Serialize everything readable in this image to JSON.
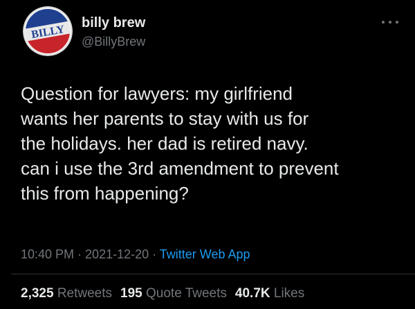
{
  "user": {
    "display_name": "billy brew",
    "handle": "@BillyBrew",
    "avatar_text": "BILLY"
  },
  "tweet": {
    "lines": [
      "Question for lawyers: my girlfriend",
      "wants her parents to stay with us for",
      "the holidays. her dad is retired navy.",
      "can i use the 3rd amendment to prevent",
      "this from happening?"
    ]
  },
  "meta": {
    "time": "10:40 PM",
    "separator": " · ",
    "date": "2021-12-20",
    "source": "Twitter Web App"
  },
  "stats": {
    "retweets_count": "2,325",
    "retweets_label": "Retweets",
    "quotes_count": "195",
    "quotes_label": "Quote Tweets",
    "likes_count": "40.7K",
    "likes_label": "Likes"
  },
  "icons": {
    "more": "more-dots-icon"
  },
  "colors": {
    "background": "#000000",
    "text": "#e7e9ea",
    "secondary": "#71767b",
    "link": "#1d9bf0"
  }
}
